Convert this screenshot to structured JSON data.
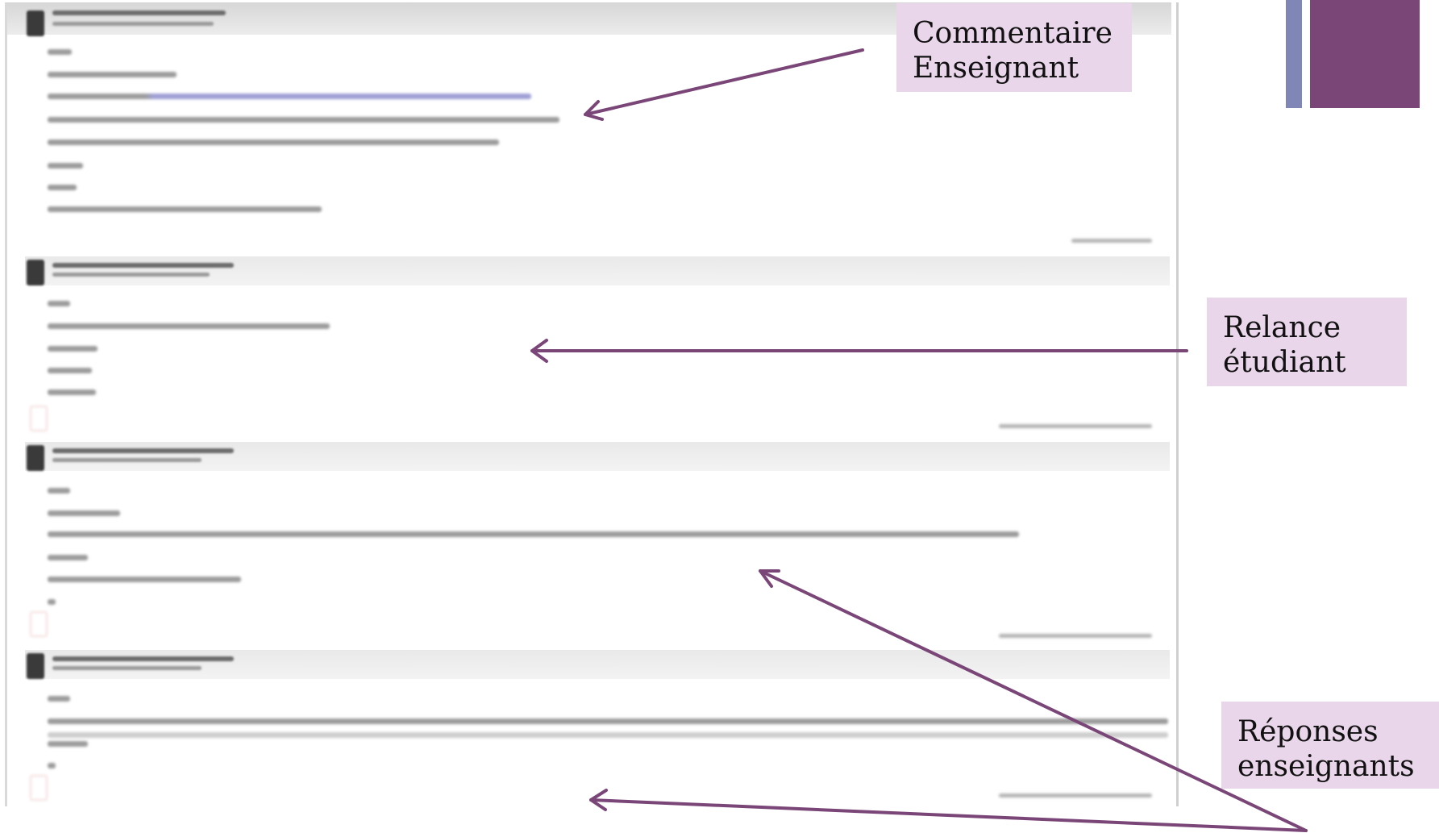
{
  "callouts": {
    "commentaire_enseignant": [
      "Commentaire",
      "Enseignant"
    ],
    "relance_etudiant": [
      "Relance",
      "étudiant"
    ],
    "reponses_enseignants": [
      "Réponses",
      "enseignants"
    ]
  },
  "colors": {
    "accent_purple": "#7a4678",
    "accent_lavender": "#8087b6",
    "callout_background": "#ead6ea",
    "arrow": "#7a4678"
  },
  "icons": {
    "avatar": "avatar-icon",
    "arrow": "arrow-icon"
  }
}
